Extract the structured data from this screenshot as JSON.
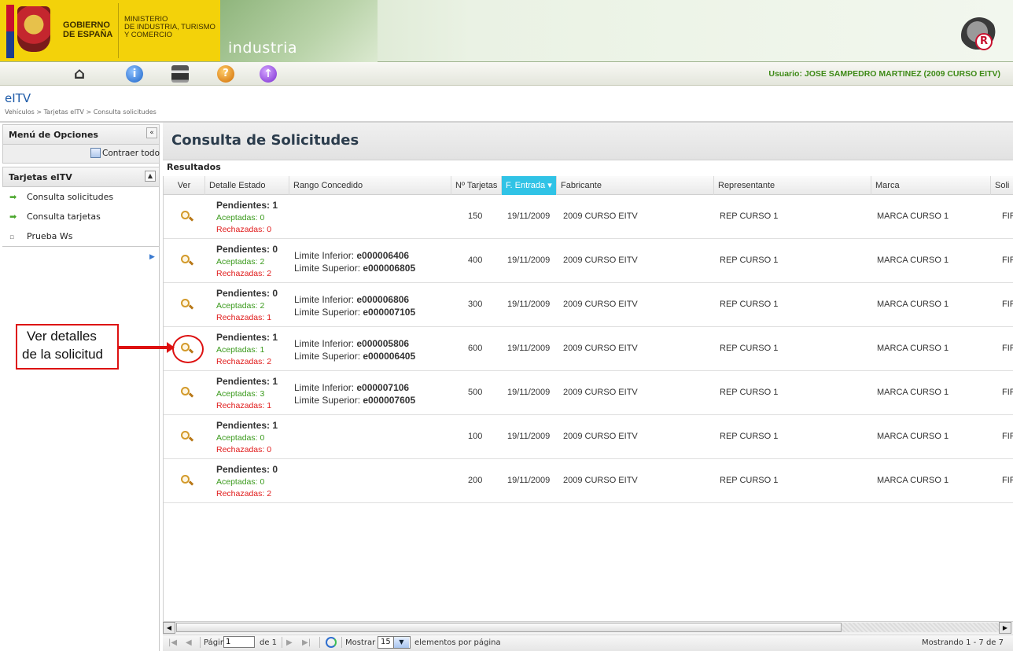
{
  "header": {
    "gobierno_line1": "GOBIERNO",
    "gobierno_line2": "DE ESPAÑA",
    "ministerio_line1": "MINISTERIO",
    "ministerio_line2": "DE INDUSTRIA, TURISMO",
    "ministerio_line3": "Y COMERCIO",
    "site": "industria",
    "badge_letter": "R"
  },
  "toolbar": {
    "user": "Usuario: JOSE SAMPEDRO MARTINEZ (2009 CURSO EITV)",
    "icons": [
      "home-icon",
      "info-icon",
      "print-icon",
      "help-icon",
      "up-icon"
    ],
    "info_glyph": "i",
    "help_glyph": "?",
    "up_glyph": "↑"
  },
  "page": {
    "app_title": "eITV",
    "breadcrumb": "Vehículos > Tarjetas eITV > Consulta solicitudes",
    "title": "Consulta de Solicitudes",
    "results_label": "Resultados"
  },
  "sidebar": {
    "menu_title": "Menú de Opciones",
    "collapse_glyph": "«",
    "contraer_label": "Contraer todo",
    "section_title": "Tarjetas eITV",
    "section_glyph": "▲",
    "items": [
      {
        "label": "Consulta solicitudes",
        "icon": "green-arrow-icon"
      },
      {
        "label": "Consulta tarjetas",
        "icon": "green-arrow-icon"
      },
      {
        "label": "Prueba Ws",
        "icon": "square-icon"
      }
    ],
    "item_arrow": "➡",
    "item_square": "▫",
    "submenu_glyph": "▶"
  },
  "grid": {
    "columns": [
      "Ver",
      "Detalle Estado",
      "Rango Concedido",
      "Nº Tarjetas",
      "F. Entrada",
      "Fabricante",
      "Representante",
      "Marca",
      "Soli"
    ],
    "sorted_column": "F. Entrada",
    "sort_glyph": "▾",
    "rows": [
      {
        "pend": "Pendientes: 1",
        "acc": "Aceptadas: 0",
        "rech": "Rechazadas: 0",
        "rango_inf_label": "",
        "rango_inf": "",
        "rango_sup_label": "",
        "rango_sup": "",
        "num": "150",
        "fecha": "19/11/2009",
        "fab": "2009 CURSO EITV",
        "rep": "REP CURSO 1",
        "marca": "MARCA CURSO 1",
        "sol": "FIRI"
      },
      {
        "pend": "Pendientes: 0",
        "acc": "Aceptadas: 2",
        "rech": "Rechazadas: 2",
        "rango_inf_label": "Limite Inferior: ",
        "rango_inf": "e000006406",
        "rango_sup_label": "Limite Superior: ",
        "rango_sup": "e000006805",
        "num": "400",
        "fecha": "19/11/2009",
        "fab": "2009 CURSO EITV",
        "rep": "REP CURSO 1",
        "marca": "MARCA CURSO 1",
        "sol": "FIRI"
      },
      {
        "pend": "Pendientes: 0",
        "acc": "Aceptadas: 2",
        "rech": "Rechazadas: 1",
        "rango_inf_label": "Limite Inferior: ",
        "rango_inf": "e000006806",
        "rango_sup_label": "Limite Superior: ",
        "rango_sup": "e000007105",
        "num": "300",
        "fecha": "19/11/2009",
        "fab": "2009 CURSO EITV",
        "rep": "REP CURSO 1",
        "marca": "MARCA CURSO 1",
        "sol": "FIRI"
      },
      {
        "pend": "Pendientes: 1",
        "acc": "Aceptadas: 1",
        "rech": "Rechazadas: 2",
        "rango_inf_label": "Limite Inferior: ",
        "rango_inf": "e000005806",
        "rango_sup_label": "Limite Superior: ",
        "rango_sup": "e000006405",
        "num": "600",
        "fecha": "19/11/2009",
        "fab": "2009 CURSO EITV",
        "rep": "REP CURSO 1",
        "marca": "MARCA CURSO 1",
        "sol": "FIRI"
      },
      {
        "pend": "Pendientes: 1",
        "acc": "Aceptadas: 3",
        "rech": "Rechazadas: 1",
        "rango_inf_label": "Limite Inferior: ",
        "rango_inf": "e000007106",
        "rango_sup_label": "Limite Superior: ",
        "rango_sup": "e000007605",
        "num": "500",
        "fecha": "19/11/2009",
        "fab": "2009 CURSO EITV",
        "rep": "REP CURSO 1",
        "marca": "MARCA CURSO 1",
        "sol": "FIRI"
      },
      {
        "pend": "Pendientes: 1",
        "acc": "Aceptadas: 0",
        "rech": "Rechazadas: 0",
        "rango_inf_label": "",
        "rango_inf": "",
        "rango_sup_label": "",
        "rango_sup": "",
        "num": "100",
        "fecha": "19/11/2009",
        "fab": "2009 CURSO EITV",
        "rep": "REP CURSO 1",
        "marca": "MARCA CURSO 1",
        "sol": "FIRI"
      },
      {
        "pend": "Pendientes: 0",
        "acc": "Aceptadas: 0",
        "rech": "Rechazadas: 2",
        "rango_inf_label": "",
        "rango_inf": "",
        "rango_sup_label": "",
        "rango_sup": "",
        "num": "200",
        "fecha": "19/11/2009",
        "fab": "2009 CURSO EITV",
        "rep": "REP CURSO 1",
        "marca": "MARCA CURSO 1",
        "sol": "FIRI"
      }
    ]
  },
  "callout": {
    "line1": "Ver detalles",
    "line2": "de la solicitud"
  },
  "pager": {
    "first_glyph": "|◀",
    "prev_glyph": "◀",
    "page_label": "Página",
    "page_value": "1",
    "of_label": "de 1",
    "next_glyph": "▶",
    "last_glyph": "▶|",
    "show_label": "Mostrar",
    "per_page_value": "15",
    "per_page_suffix": "elementos por página",
    "showing": "Mostrando 1 - 7 de 7",
    "scroll_left_glyph": "◀",
    "scroll_right_glyph": "▶",
    "select_glyph": "▼"
  },
  "colors": {
    "accent": "#30c3e6",
    "user_text": "#3e8a17",
    "accepted": "#3a9a1c",
    "rejected": "#e01b1b",
    "callout": "#dd1111"
  }
}
